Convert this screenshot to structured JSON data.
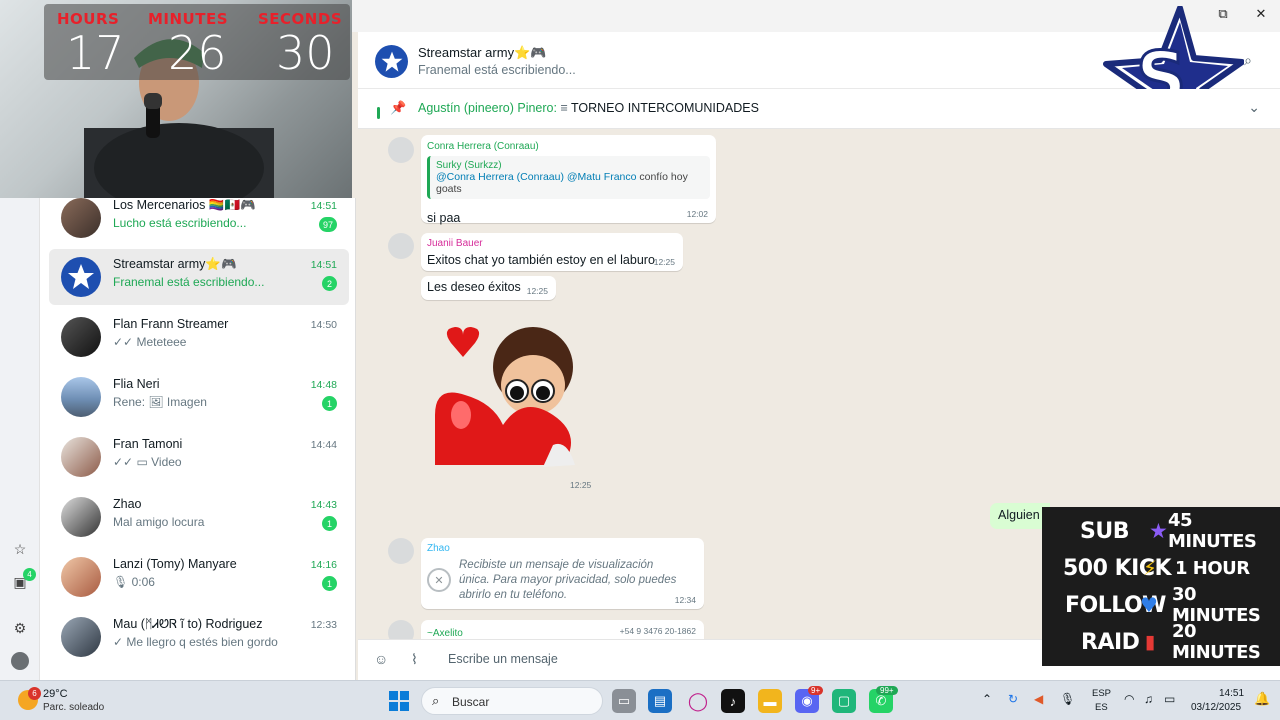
{
  "window": {
    "restore_glyph": "⧉",
    "close_glyph": "✕"
  },
  "timer": {
    "hours_label": "HOURS",
    "minutes_label": "MINUTES",
    "seconds_label": "SECONDS",
    "hours": "17",
    "minutes": "26",
    "seconds": "30"
  },
  "chats": [
    {
      "name": "Los Mercenarios 🏳️‍🌈🇲🇽🎮",
      "time": "14:51",
      "preview": "Lucho  está escribiendo...",
      "badge": "97",
      "time_green": true,
      "preview_green": true
    },
    {
      "name": "Streamstar army⭐🎮",
      "time": "14:51",
      "preview": "Franemal está escribiendo...",
      "badge": "2",
      "time_green": true,
      "preview_green": true
    },
    {
      "name": "Flan Frann Streamer",
      "time": "14:50",
      "preview": "✓✓ Meteteee",
      "badge": ""
    },
    {
      "name": "Flia Neri",
      "time": "14:48",
      "preview": "Rene: 🖼 Imagen",
      "badge": "1",
      "time_green": true
    },
    {
      "name": "Fran Tamoni",
      "time": "14:44",
      "preview": "✓✓ ▭ Video",
      "badge": ""
    },
    {
      "name": "Zhao",
      "time": "14:43",
      "preview": "Mal amigo locura",
      "badge": "1",
      "time_green": true
    },
    {
      "name": "Lanzi (Tomy) Manyare",
      "time": "14:16",
      "preview": "🎙 0:06",
      "badge": "1",
      "time_green": true
    },
    {
      "name": "Mau (ᛗᏗᏬᏒ ĩ to) Rodriguez",
      "time": "12:33",
      "preview": "✓ Me llegro q estés bien gordo",
      "badge": ""
    }
  ],
  "rail": {
    "starred_icon": "star-icon",
    "archive_badge": "4"
  },
  "header": {
    "name": "Streamstar army⭐🎮",
    "status": "Franemal está escribiendo..."
  },
  "pinned": {
    "author": "Agustín (pineero) Pinero:",
    "text": "TORNEO INTERCOMUNIDADES"
  },
  "messages": {
    "m1": {
      "sender": "Conra  Herrera (Conraau)",
      "quote_author": "Surky (Surkzz)",
      "quote_mention": "@Conra  Herrera (Conraau) @Matu Franco",
      "quote_text": "confío hoy goats",
      "text": "si paa",
      "time": "12:02"
    },
    "m2": {
      "sender": "Juanii Bauer",
      "text": "Exitos chat yo también estoy en el laburo",
      "time": "12:25"
    },
    "m3": {
      "text": "Les deseo éxitos",
      "time": "12:25"
    },
    "sticker_time": "12:25",
    "sent": {
      "text": "Alguien m"
    },
    "m4": {
      "sender": "Zhao",
      "text": "Recibiste un mensaje de visualización única. Para mayor privacidad, solo puedes abrirlo en tu teléfono.",
      "time": "12:34"
    },
    "m5": {
      "sender": "~Axelito",
      "phone": "+54 9 3476 20-1862"
    }
  },
  "composer": {
    "placeholder": "Escribe un mensaje"
  },
  "overlay": {
    "rows": [
      {
        "key": "SUB",
        "icon": "★",
        "value": "45 MINUTES",
        "color": "#8b5cf6"
      },
      {
        "key": "500 KICK",
        "icon": "⚡",
        "value": "1 HOUR",
        "color": "#f4c20d"
      },
      {
        "key": "FOLLOW",
        "icon": "♥",
        "value": "30 MINUTES",
        "color": "#2f7ee8"
      },
      {
        "key": "RAID",
        "icon": "▮",
        "value": "20 MINUTES",
        "color": "#e53935"
      }
    ]
  },
  "taskbar": {
    "weather_temp": "29°C",
    "weather_desc": "Parc. soleado",
    "weather_badge": "6",
    "search_label": "Buscar",
    "whatsapp_badge": "99+",
    "discord_badge": "9+",
    "lang_top": "ESP",
    "lang_bottom": "ES",
    "time": "14:51",
    "date": "03/12/2025"
  }
}
